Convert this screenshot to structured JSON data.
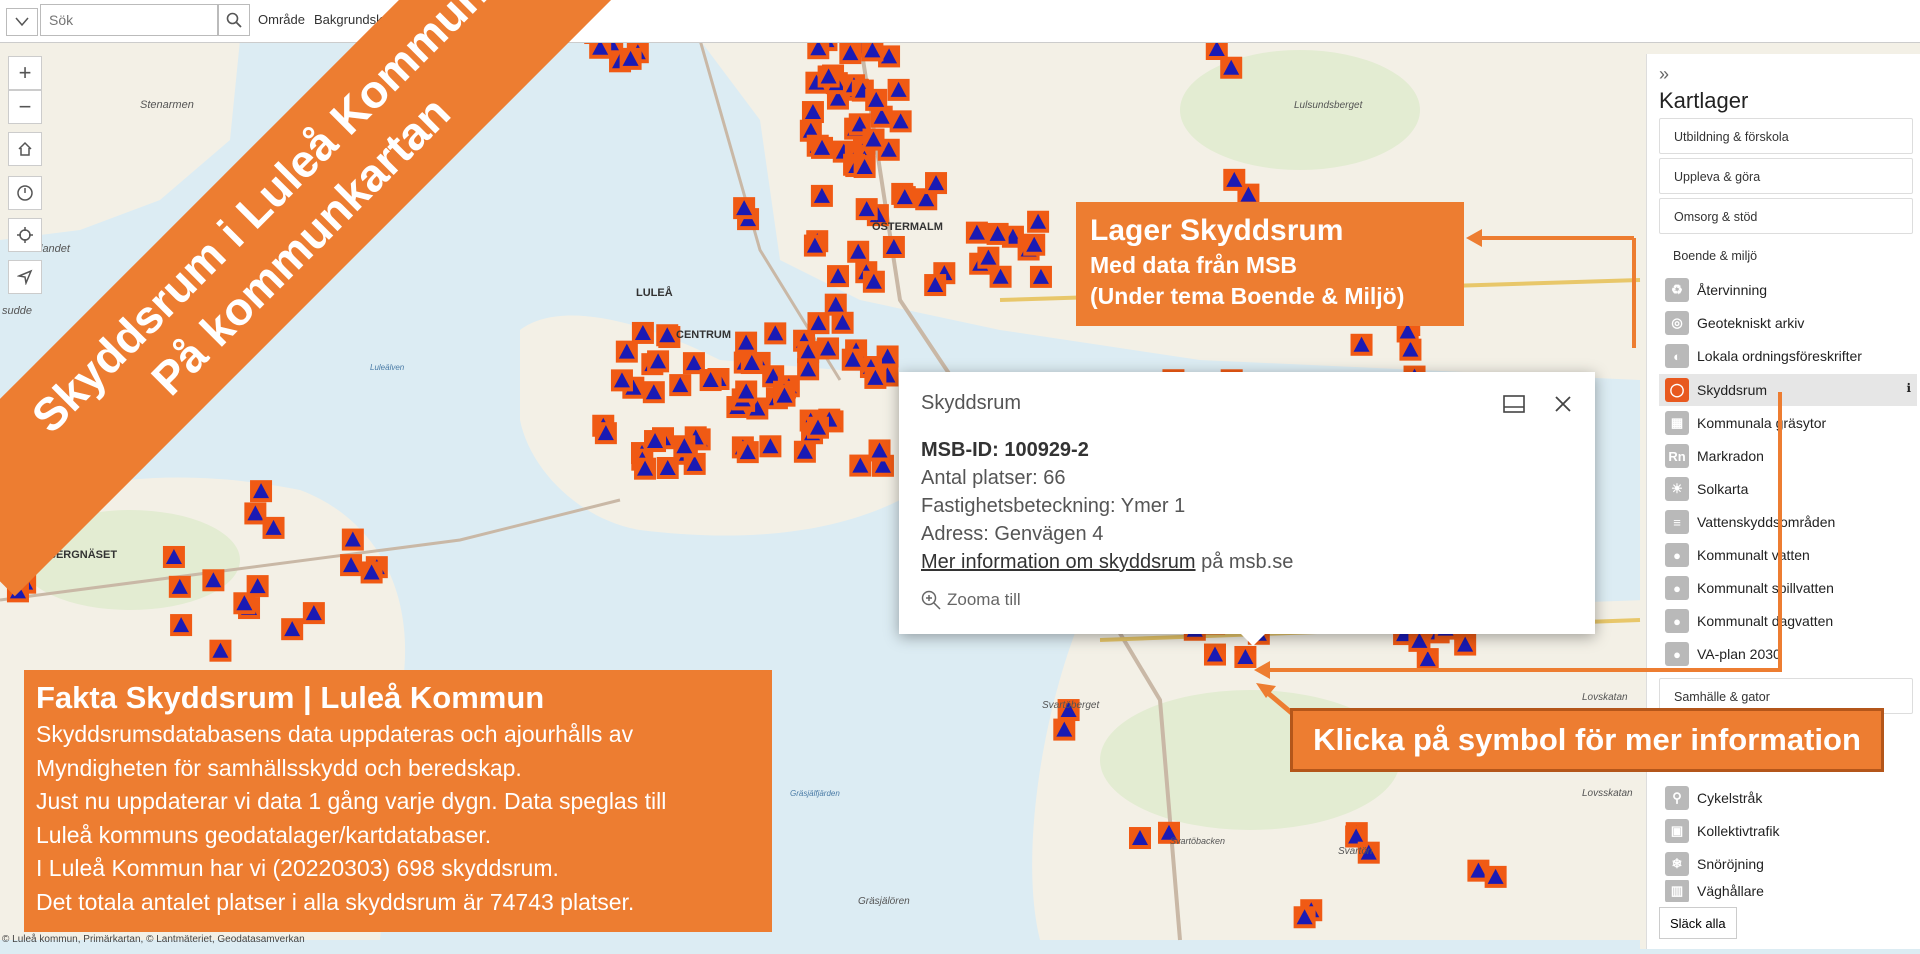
{
  "topbar": {
    "search_placeholder": "Sök",
    "links": [
      "Område",
      "Bakgrundskarta"
    ]
  },
  "map": {
    "controls": {
      "zoom_in": "+",
      "zoom_out": "−"
    },
    "place_labels": [
      "Stenarmen",
      "ÖSTERMALM",
      "LULEÅ",
      "CENTRUM",
      "BERGNÄSET",
      "Luleälven",
      "Svartöberget",
      "Lovskatan",
      "Lovsskatan",
      "Gräsjälfjärden",
      "Svartöbacken",
      "Svartön",
      "Gräsjälören",
      "Lulsundsberget",
      "landet",
      "sudde"
    ]
  },
  "banner": {
    "line1": "Skyddsrum i Luleå Kommun",
    "line2": "På kommunkartan"
  },
  "sidepanel": {
    "collapse_glyph": "»",
    "title": "Kartlager",
    "sections": [
      "Utbildning & förskola",
      "Uppleva & göra",
      "Omsorg & stöd",
      "Boende & miljö"
    ],
    "items": [
      {
        "label": "Återvinning",
        "icon": "recycle-icon"
      },
      {
        "label": "Geotekniskt arkiv",
        "icon": "archive-icon"
      },
      {
        "label": "Lokala ordningsföreskrifter",
        "icon": "rules-icon"
      },
      {
        "label": "Skyddsrum",
        "icon": "shelter-icon",
        "active": true,
        "info": "ℹ"
      },
      {
        "label": "Kommunala gräsytor",
        "icon": "grass-icon"
      },
      {
        "label": "Markradon",
        "icon": "radon-icon",
        "icon_text": "Rn"
      },
      {
        "label": "Solkarta",
        "icon": "sun-icon"
      },
      {
        "label": "Vattenskyddsområden",
        "icon": "water-protection-icon"
      },
      {
        "label": "Kommunalt vatten",
        "icon": "water-drop-icon"
      },
      {
        "label": "Kommunalt spillvatten",
        "icon": "wastewater-icon"
      },
      {
        "label": "Kommunalt dagvatten",
        "icon": "stormwater-icon"
      },
      {
        "label": "VA-plan 2030",
        "icon": "va-plan-icon"
      }
    ],
    "section2": "Samhälle & gator",
    "items2": [
      {
        "label": "Cykelstråk",
        "icon": "bicycle-icon"
      },
      {
        "label": "Kollektivtrafik",
        "icon": "bus-icon"
      },
      {
        "label": "Snöröjning",
        "icon": "snowflake-icon"
      },
      {
        "label": "Väghållare",
        "icon": "road-icon"
      }
    ],
    "footer_button": "Släck alla"
  },
  "popup": {
    "title": "Skyddsrum",
    "msb_id": "MSB-ID: 100929-2",
    "places": "Antal platser: 66",
    "property": "Fastighetsbeteckning: Ymer 1",
    "address": "Adress: Genvägen 4",
    "link_text": "Mer information om skyddsrum",
    "link_suffix": " på msb.se",
    "zoom_label": "Zooma till"
  },
  "callouts": {
    "layer_title": "Lager Skyddsrum",
    "layer_line2": "Med data från MSB",
    "layer_line3": "(Under tema Boende & Miljö)",
    "click_text": "Klicka på symbol för mer information"
  },
  "factbox": {
    "title": "Fakta Skyddsrum | Luleå Kommun",
    "lines": [
      "Skyddsrumsdatabasens data uppdateras och ajourhålls av",
      "Myndigheten för samhällsskydd och beredskap.",
      "Just nu uppdaterar vi data 1 gång varje dygn. Data speglas till",
      "Luleå kommuns geodatalager/kartdatabaser.",
      "I Luleå Kommun har vi (20220303) 698 skyddsrum.",
      "Det totala antalet platser i alla skyddsrum är 74743 platser."
    ]
  },
  "attribution": "© Luleå kommun, Primärkartan, © Lantmäteriet, Geodatasamverkan",
  "colors": {
    "accent_orange": "#ed7d31",
    "marker_orange": "#f05a14",
    "marker_triangle": "#1a1ab4",
    "water": "#dcecf3",
    "land": "#f3f0e6"
  }
}
